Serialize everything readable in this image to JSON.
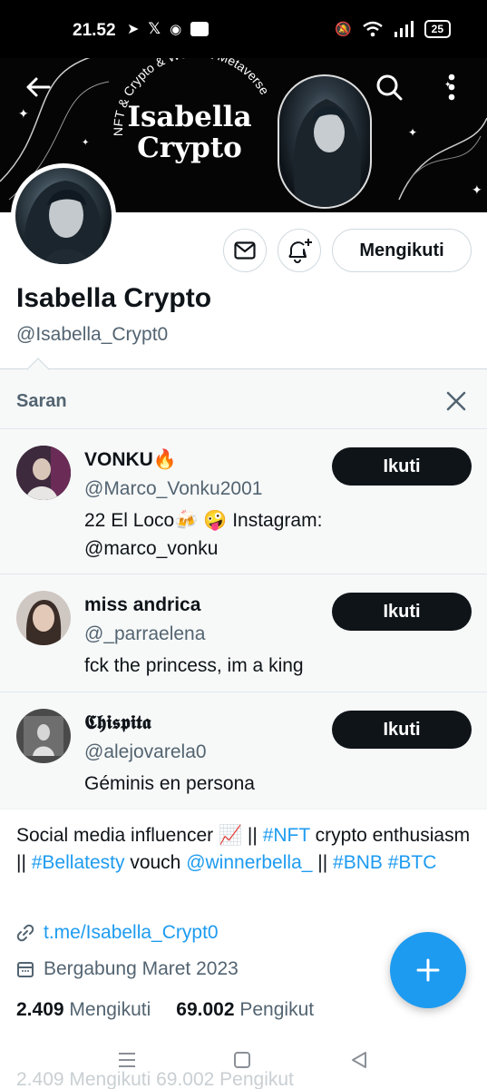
{
  "status_bar": {
    "time": "21.52",
    "battery": "25"
  },
  "banner": {
    "title_line1": "Isabella",
    "title_line2": "Crypto",
    "arc_text": "NFT & Crypto & Web3 & Metaverse"
  },
  "profile": {
    "name": "Isabella Crypto",
    "handle": "@Isabella_Crypt0",
    "follow_state_label": "Mengikuti",
    "bio_segments": [
      {
        "text": "Social media influencer 📈 || ",
        "link": false
      },
      {
        "text": "#NFT",
        "link": true
      },
      {
        "text": " crypto enthusiasm || ",
        "link": false
      },
      {
        "text": "#Bellatesty",
        "link": true
      },
      {
        "text": " vouch ",
        "link": false
      },
      {
        "text": "@winnerbella_",
        "link": true
      },
      {
        "text": " || ",
        "link": false
      },
      {
        "text": "#BNB",
        "link": true
      },
      {
        "text": " ",
        "link": false
      },
      {
        "text": "#BTC",
        "link": true
      }
    ],
    "website": "t.me/Isabella_Crypt0",
    "joined": "Bergabung Maret 2023",
    "following_count": "2.409",
    "following_label": "Mengikuti",
    "followers_count": "69.002",
    "followers_label": "Pengikut"
  },
  "suggestions": {
    "title": "Saran",
    "follow_label": "Ikuti",
    "items": [
      {
        "name": "VONKU🔥",
        "handle": "@Marco_Vonku2001",
        "bio_line1": "22 El Loco🍻 🤪 Instagram:",
        "bio_line2": "@marco_vonku"
      },
      {
        "name": "miss andrica",
        "handle": "@_parraelena",
        "bio_line1": "fck the princess, im a king",
        "bio_line2": ""
      },
      {
        "name": "𝕮𝖍𝖎𝖘𝖕𝖎𝖙𝖆",
        "handle": "@alejovarela0",
        "bio_line1": "Géminis en persona",
        "bio_line2": ""
      }
    ]
  },
  "ghost_stats": "2.409 Mengikuti   69.002 Pengikut",
  "colors": {
    "accent": "#1d9bf0",
    "text": "#0f1419",
    "muted": "#536471"
  },
  "icons": [
    "back-arrow-icon",
    "search-icon",
    "more-vertical-icon",
    "mail-icon",
    "bell-plus-icon",
    "close-icon",
    "link-icon",
    "calendar-icon",
    "plus-icon",
    "menu-icon",
    "home-square-icon",
    "back-triangle-icon"
  ]
}
